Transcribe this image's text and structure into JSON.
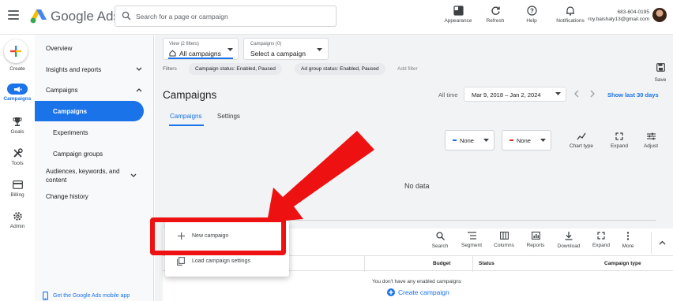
{
  "topbar": {
    "brand": "Google Ads",
    "search_placeholder": "Search for a page or campaign",
    "actions": [
      {
        "label": "Appearance",
        "icon": "appearance-icon"
      },
      {
        "label": "Refresh",
        "icon": "refresh-icon"
      },
      {
        "label": "Help",
        "icon": "help-icon"
      },
      {
        "label": "Notifications",
        "icon": "bell-icon"
      }
    ],
    "account_id": "683-604-0195",
    "account_email": "roy.baishaly13@gmail.com"
  },
  "rail": {
    "items": [
      {
        "label": "Create",
        "icon": "plus-icon"
      },
      {
        "label": "Campaigns",
        "icon": "megaphone-icon"
      },
      {
        "label": "Goals",
        "icon": "trophy-icon"
      },
      {
        "label": "Tools",
        "icon": "tools-icon"
      },
      {
        "label": "Billing",
        "icon": "credit-card-icon"
      },
      {
        "label": "Admin",
        "icon": "gear-icon"
      }
    ]
  },
  "sidenav": {
    "items": [
      {
        "label": "Overview"
      },
      {
        "label": "Insights and reports"
      },
      {
        "label": "Campaigns"
      },
      {
        "label": "Campaigns"
      },
      {
        "label": "Experiments"
      },
      {
        "label": "Campaign groups"
      },
      {
        "label": "Audiences, keywords, and content"
      },
      {
        "label": "Change history"
      }
    ],
    "mobile_app": "Get the Google Ads mobile app"
  },
  "main": {
    "view_caption": "View (2 filters)",
    "view_value": "All campaigns",
    "campaigns_caption": "Campaigns (0)",
    "campaigns_value": "Select a campaign",
    "filters_label": "Filters",
    "chips": [
      "Campaign status: Enabled, Paused",
      "Ad group status: Enabled, Paused"
    ],
    "add_filter": "Add filter",
    "save_label": "Save",
    "title": "Campaigns",
    "all_time": "All time",
    "date_range": "Mar 9, 2018 – Jan 2, 2024",
    "last_30": "Show last 30 days",
    "tabs": [
      "Campaigns",
      "Settings"
    ],
    "metric_1": "None",
    "metric_2": "None",
    "metric_1_color": "#1a73e8",
    "metric_2_color": "#d93025",
    "chart_tools": [
      "Chart type",
      "Expand",
      "Adjust"
    ],
    "no_data": "No data",
    "table_tools": [
      "Search",
      "Segment",
      "Columns",
      "Reports",
      "Download",
      "Expand",
      "More"
    ],
    "columns": [
      "Budget",
      "Status",
      "Campaign type"
    ],
    "empty_msg": "You don't have any enabled campaigns",
    "create_campaign": "Create campaign"
  },
  "popup": {
    "items": [
      "New campaign",
      "Load campaign settings"
    ]
  },
  "colors": {
    "accent": "#1a73e8",
    "annotation": "#ee1111"
  }
}
